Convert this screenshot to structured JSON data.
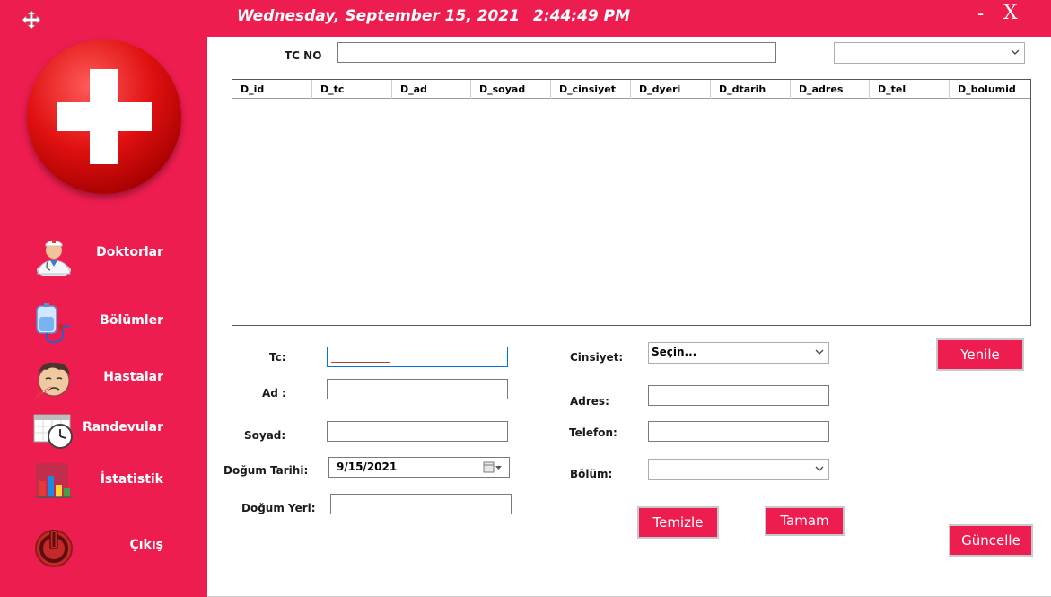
{
  "titlebar": {
    "date": "Wednesday, September 15, 2021",
    "time": "2:44:49 PM",
    "minimize": "-",
    "close": "X"
  },
  "sidebar": {
    "items": [
      {
        "label": "Doktorlar",
        "icon": "doctor-icon"
      },
      {
        "label": "Bölümler",
        "icon": "iv-bag-icon"
      },
      {
        "label": "Hastalar",
        "icon": "sick-patient-icon"
      },
      {
        "label": "Randevular",
        "icon": "calendar-clock-icon"
      },
      {
        "label": "İstatistik",
        "icon": "bar-chart-icon"
      },
      {
        "label": "Çıkış",
        "icon": "power-icon"
      }
    ]
  },
  "search": {
    "label": "TC NO",
    "value": "",
    "filter_value": ""
  },
  "grid": {
    "columns": [
      "D_id",
      "D_tc",
      "D_ad",
      "D_soyad",
      "D_cinsiyet",
      "D_dyeri",
      "D_dtarih",
      "D_adres",
      "D_tel",
      "D_bolumid"
    ],
    "rows": []
  },
  "form": {
    "tc_label": "Tc:",
    "tc_value": "",
    "ad_label": "Ad :",
    "ad_value": "",
    "soyad_label": "Soyad:",
    "soyad_value": "",
    "dogum_tarihi_label": "Doğum Tarihi:",
    "dogum_tarihi_value": "9/15/2021",
    "dogum_yeri_label": "Doğum Yeri:",
    "dogum_yeri_value": "",
    "cinsiyet_label": "Cinsiyet:",
    "cinsiyet_value": "Seçin...",
    "adres_label": "Adres:",
    "adres_value": "",
    "telefon_label": "Telefon:",
    "telefon_value": "",
    "bolum_label": "Bölüm:",
    "bolum_value": ""
  },
  "buttons": {
    "yenile": "Yenile",
    "temizle": "Temizle",
    "tamam": "Tamam",
    "guncelle": "Güncelle"
  },
  "colors": {
    "accent": "#ee1d4f",
    "background": "#ffffff"
  }
}
